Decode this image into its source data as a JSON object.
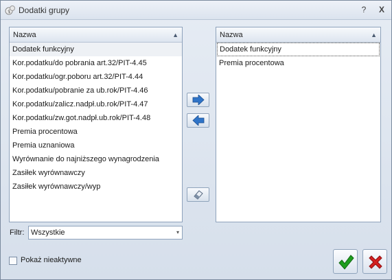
{
  "window": {
    "title": "Dodatki grupy",
    "help_glyph": "?",
    "close_glyph": "X"
  },
  "left_list": {
    "header": "Nazwa",
    "sort_glyph": "▲",
    "items": [
      "Dodatek funkcyjny",
      "Kor.podatku/do pobrania art.32/PIT-4.45",
      "Kor.podatku/ogr.poboru art.32/PIT-4.44",
      "Kor.podatku/pobranie za ub.rok/PIT-4.46",
      "Kor.podatku/zalicz.nadpł.ub.rok/PIT-4.47",
      "Kor.podatku/zw.got.nadpł.ub.rok/PIT-4.48",
      "Premia procentowa",
      "Premia uznaniowa",
      "Wyrównanie do najniższego wynagrodzenia",
      "Zasiłek wyrównawczy",
      "Zasiłek wyrównawczy/wyp"
    ],
    "selected_index": 0
  },
  "right_list": {
    "header": "Nazwa",
    "sort_glyph": "▲",
    "items": [
      "Dodatek funkcyjny",
      "Premia procentowa"
    ],
    "focused_index": 0
  },
  "filter": {
    "label": "Filtr:",
    "value": "Wszystkie",
    "caret": "▾"
  },
  "show_inactive": {
    "label": "Pokaż nieaktywne",
    "checked": false
  },
  "icons": {
    "move_right": "arrow-right-icon",
    "move_left": "arrow-left-icon",
    "clear": "eraser-icon",
    "ok": "checkmark-icon",
    "cancel": "cross-icon"
  },
  "colors": {
    "ok_green": "#1e9e1e",
    "cancel_red": "#d42020",
    "arrow_blue": "#2f74c8"
  }
}
